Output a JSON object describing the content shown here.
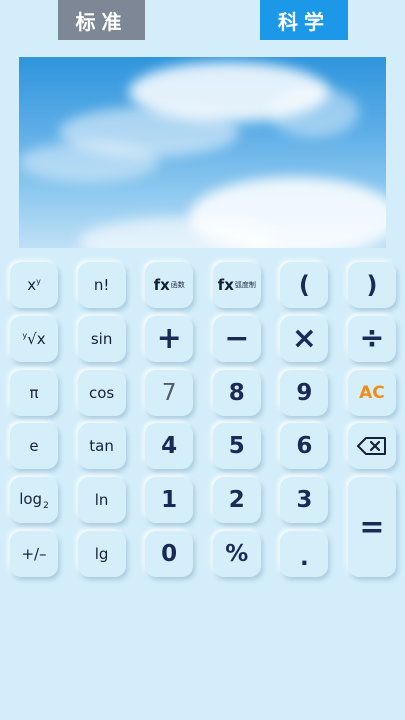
{
  "tabs": {
    "standard": "标准",
    "scientific": "科学"
  },
  "keys": {
    "xpow": {
      "base": "x",
      "exp": "y"
    },
    "fact": "n!",
    "fx_fn": {
      "main": "fx",
      "sub": "函数"
    },
    "fx_arc": {
      "main": "fx",
      "sub": "弧度制"
    },
    "lparen": "(",
    "rparen": ")",
    "root": {
      "idx": "y",
      "sym": "√x"
    },
    "sin": "sin",
    "plus": "+",
    "minus": "−",
    "times": "×",
    "divide": "÷",
    "pi": "π",
    "cos": "cos",
    "d7": "7",
    "d8": "8",
    "d9": "9",
    "ac": "AC",
    "e": "e",
    "tan": "tan",
    "d4": "4",
    "d5": "5",
    "d6": "6",
    "log2": {
      "base": "log",
      "sub": "2"
    },
    "ln": "ln",
    "d1": "1",
    "d2": "2",
    "d3": "3",
    "equals": "=",
    "negate": "+/–",
    "lg": "lg",
    "d0": "0",
    "percent": "%",
    "dot": "."
  },
  "colors": {
    "accent": "#1b98e8",
    "ac": "#f28c18",
    "background": "#d3eefa",
    "tab_inactive": "#7d8796"
  },
  "icons": {
    "backspace": "backspace-icon"
  }
}
